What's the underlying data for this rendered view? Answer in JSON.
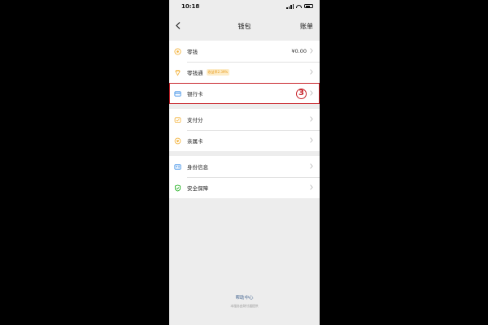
{
  "status_bar": {
    "time": "10:18"
  },
  "nav": {
    "back_icon": "chevron-left-icon",
    "back": "<",
    "title": "钱包",
    "action": "账单"
  },
  "groups": [
    [
      {
        "key": "change",
        "label": "零钱",
        "value": "¥0.00",
        "icon": "coin-icon",
        "icon_color": "#f3b33d"
      },
      {
        "key": "lingqiantong",
        "label": "零钱通",
        "badge": "收益率2.39%",
        "icon": "diamond-icon",
        "icon_color": "#f3b33d"
      },
      {
        "key": "bank-card",
        "label": "银行卡",
        "step": "3",
        "highlight": true,
        "icon": "card-icon",
        "icon_color": "#3a8ee6"
      }
    ],
    [
      {
        "key": "payscore",
        "label": "支付分",
        "icon": "score-icon",
        "icon_color": "#f3b33d"
      },
      {
        "key": "family-card",
        "label": "亲属卡",
        "icon": "family-card-icon",
        "icon_color": "#f3b33d"
      }
    ],
    [
      {
        "key": "identity",
        "label": "身份信息",
        "icon": "id-card-icon",
        "icon_color": "#3a8ee6"
      },
      {
        "key": "security",
        "label": "安全保障",
        "icon": "shield-icon",
        "icon_color": "#1aad19"
      }
    ]
  ],
  "footer": {
    "help": "帮助中心",
    "note": "本服务由财付通提供"
  },
  "colors": {
    "highlight": "#c8242b",
    "link": "#4a6a94"
  }
}
